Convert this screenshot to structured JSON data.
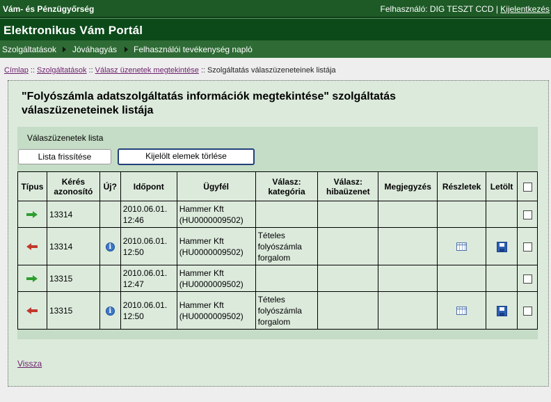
{
  "header": {
    "org": "Vám- és Pénzügyőrség",
    "user_text": "Felhasználó: DIG TESZT CCD |",
    "logout": "Kijelentkezés",
    "portal_title": "Elektronikus Vám Portál"
  },
  "nav": [
    {
      "label": "Szolgáltatások"
    },
    {
      "label": "Jóváhagyás"
    },
    {
      "label": "Felhasználói tevékenység napló"
    }
  ],
  "breadcrumb": {
    "home": "Címlap",
    "services": "Szolgáltatások",
    "responses": "Válasz üzenetek megtekintése",
    "current": "Szolgáltatás válaszüzeneteinek listája",
    "sep": "::"
  },
  "page": {
    "heading_line1": "\"Folyószámla adatszolgáltatás információk megtekintése\" szolgáltatás",
    "heading_line2": "válaszüzeneteinek listája",
    "list_title": "Válaszüzenetek lista",
    "refresh_button": "Lista frissítése",
    "delete_button": "Kijelölt elemek törlése",
    "back_link": "Vissza"
  },
  "table": {
    "headers": {
      "type": "Típus",
      "request_id_1": "Kérés",
      "request_id_2": "azonosító",
      "new": "Új?",
      "time": "Időpont",
      "client": "Ügyfél",
      "category_1": "Válasz:",
      "category_2": "kategória",
      "error_1": "Válasz:",
      "error_2": "hibaüzenet",
      "note": "Megjegyzés",
      "details": "Részletek",
      "download": "Letölt"
    },
    "rows": [
      {
        "direction": "in",
        "id": "13314",
        "new": false,
        "date": "2010.06.01.",
        "time": "12:46",
        "client_name": "Hammer Kft",
        "client_id": "(HU0000009502)",
        "cat1": "",
        "cat2": "",
        "cat3": "",
        "has_details": false
      },
      {
        "direction": "out",
        "id": "13314",
        "new": true,
        "date": "2010.06.01.",
        "time": "12:50",
        "client_name": "Hammer Kft",
        "client_id": "(HU0000009502)",
        "cat1": "Tételes",
        "cat2": "folyószámla",
        "cat3": "forgalom",
        "has_details": true
      },
      {
        "direction": "in",
        "id": "13315",
        "new": false,
        "date": "2010.06.01.",
        "time": "12:47",
        "client_name": "Hammer Kft",
        "client_id": "(HU0000009502)",
        "cat1": "",
        "cat2": "",
        "cat3": "",
        "has_details": false
      },
      {
        "direction": "out",
        "id": "13315",
        "new": true,
        "date": "2010.06.01.",
        "time": "12:50",
        "client_name": "Hammer Kft",
        "client_id": "(HU0000009502)",
        "cat1": "Tételes",
        "cat2": "folyószámla",
        "cat3": "forgalom",
        "has_details": true
      }
    ]
  },
  "colors": {
    "header_bg": "#1d5a26",
    "title_bg": "#0c4a1a",
    "nav_bg": "#2e6b35",
    "panel_bg": "#dceadc",
    "list_bg": "#c5dcc6",
    "link": "#6b1f6b"
  }
}
